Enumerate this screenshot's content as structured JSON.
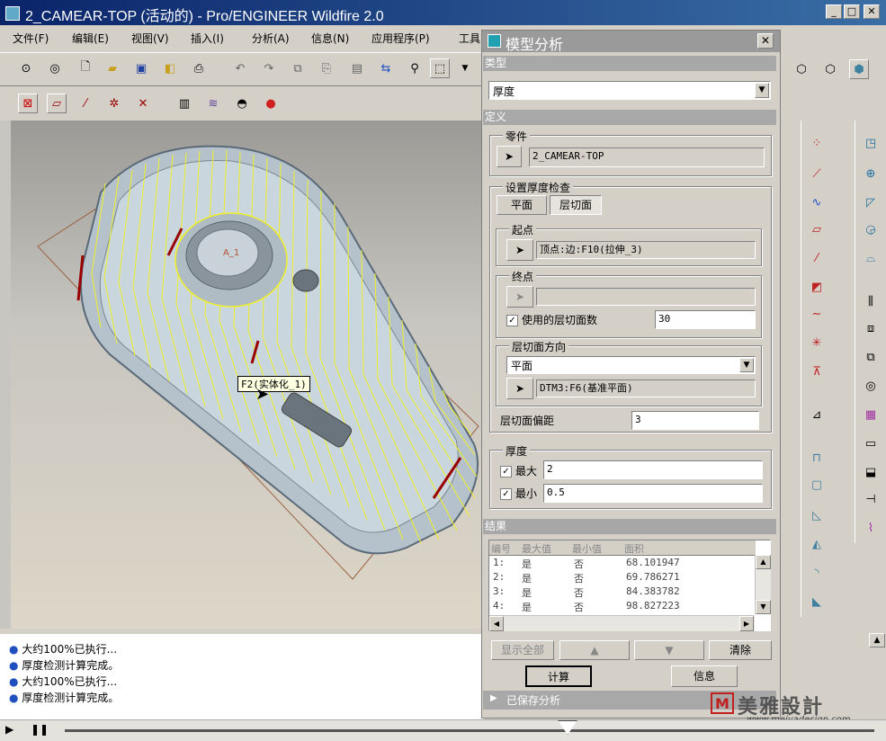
{
  "window": {
    "title": "2_CAMEAR-TOP (活动的) - Pro/ENGINEER Wildfire 2.0"
  },
  "menu": [
    "文件(F)",
    "编辑(E)",
    "视图(V)",
    "插入(I)",
    "分析(A)",
    "信息(N)",
    "应用程序(P)",
    "工具"
  ],
  "dialog": {
    "title": "模型分析",
    "type_section": "类型",
    "type_value": "厚度",
    "definition_section": "定义",
    "part_group": "零件",
    "part_value": "2_CAMEAR-TOP",
    "thickness_group": "设置厚度检查",
    "tab_plane": "平面",
    "tab_section": "层切面",
    "start_group": "起点",
    "start_value": "顶点:边:F10(拉伸_3)",
    "end_group": "终点",
    "end_value": "",
    "use_sections_label": "使用的层切面数",
    "use_sections_value": "30",
    "direction_group": "层切面方向",
    "direction_value": "平面",
    "direction_ref": "DTM3:F6(基准平面)",
    "offset_label": "层切面偏距",
    "offset_value": "3",
    "thickness_group2": "厚度",
    "max_label": "最大",
    "max_value": "2",
    "min_label": "最小",
    "min_value": "0.5",
    "results_section": "结果",
    "results_headers": [
      "编号",
      "最大值",
      "最小值",
      "面积"
    ],
    "results_rows": [
      [
        "1:",
        "是",
        "否",
        "68.101947"
      ],
      [
        "2:",
        "是",
        "否",
        "69.786271"
      ],
      [
        "3:",
        "是",
        "否",
        "84.383782"
      ],
      [
        "4:",
        "是",
        "否",
        "98.827223"
      ]
    ],
    "show_all": "显示全部",
    "clear": "清除",
    "compute": "计算",
    "info": "信息",
    "saved_analysis": "已保存分析"
  },
  "viewport": {
    "tooltip": "F2(实体化_1)",
    "label_a": "A_1"
  },
  "messages": [
    "大约100%已执行...",
    "厚度检测计算完成。",
    "大约100%已执行...",
    "厚度检测计算完成。"
  ],
  "watermark": {
    "brand": "美雅設計",
    "url": "www.meiyadesign.com"
  },
  "colors": {
    "title_bar": "#0a246a",
    "model_outline": "#f0f028",
    "background": "#d4d0c8"
  }
}
